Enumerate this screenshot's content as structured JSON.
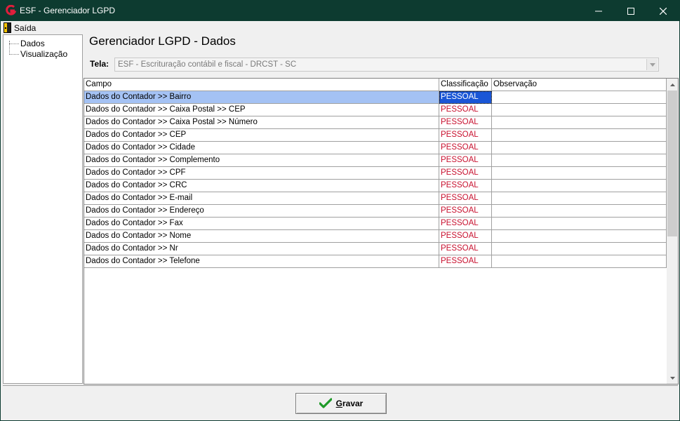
{
  "window": {
    "title": "ESF - Gerenciador LGPD",
    "icon": "esf-logo-icon",
    "controls": [
      "minimize-icon",
      "maximize-icon",
      "close-icon"
    ]
  },
  "menu": {
    "items": [
      {
        "label": "Saída",
        "icon": "exit-door-icon"
      }
    ]
  },
  "tree": {
    "items": [
      {
        "label": "Dados"
      },
      {
        "label": "Visualização"
      }
    ]
  },
  "content": {
    "title": "Gerenciador LGPD - Dados",
    "tela_label": "Tela:",
    "tela_value": "ESF - Escrituração contábil e fiscal - DRCST - SC"
  },
  "grid": {
    "columns": [
      "Campo",
      "Classificação",
      "Observação"
    ],
    "selected_row": 0,
    "rows": [
      {
        "campo": "Dados do Contador >> Bairro",
        "classificacao": "PESSOAL",
        "observacao": ""
      },
      {
        "campo": "Dados do Contador >> Caixa Postal >> CEP",
        "classificacao": "PESSOAL",
        "observacao": ""
      },
      {
        "campo": "Dados do Contador >> Caixa Postal >> Número",
        "classificacao": "PESSOAL",
        "observacao": ""
      },
      {
        "campo": "Dados do Contador >> CEP",
        "classificacao": "PESSOAL",
        "observacao": ""
      },
      {
        "campo": "Dados do Contador >> Cidade",
        "classificacao": "PESSOAL",
        "observacao": ""
      },
      {
        "campo": "Dados do Contador >> Complemento",
        "classificacao": "PESSOAL",
        "observacao": ""
      },
      {
        "campo": "Dados do Contador >> CPF",
        "classificacao": "PESSOAL",
        "observacao": ""
      },
      {
        "campo": "Dados do Contador >> CRC",
        "classificacao": "PESSOAL",
        "observacao": ""
      },
      {
        "campo": "Dados do Contador >> E-mail",
        "classificacao": "PESSOAL",
        "observacao": ""
      },
      {
        "campo": "Dados do Contador >> Endereço",
        "classificacao": "PESSOAL",
        "observacao": ""
      },
      {
        "campo": "Dados do Contador >> Fax",
        "classificacao": "PESSOAL",
        "observacao": ""
      },
      {
        "campo": "Dados do Contador >> Nome",
        "classificacao": "PESSOAL",
        "observacao": ""
      },
      {
        "campo": "Dados do Contador >> Nr",
        "classificacao": "PESSOAL",
        "observacao": ""
      },
      {
        "campo": "Dados do Contador >> Telefone",
        "classificacao": "PESSOAL",
        "observacao": ""
      }
    ]
  },
  "footer": {
    "save_label": "Gravar",
    "save_icon": "checkmark-icon"
  },
  "colors": {
    "titlebar": "#0d3b30",
    "classification_text": "#c8102e",
    "selection": "#1a56d6",
    "selection_row": "#a4c2f4"
  }
}
